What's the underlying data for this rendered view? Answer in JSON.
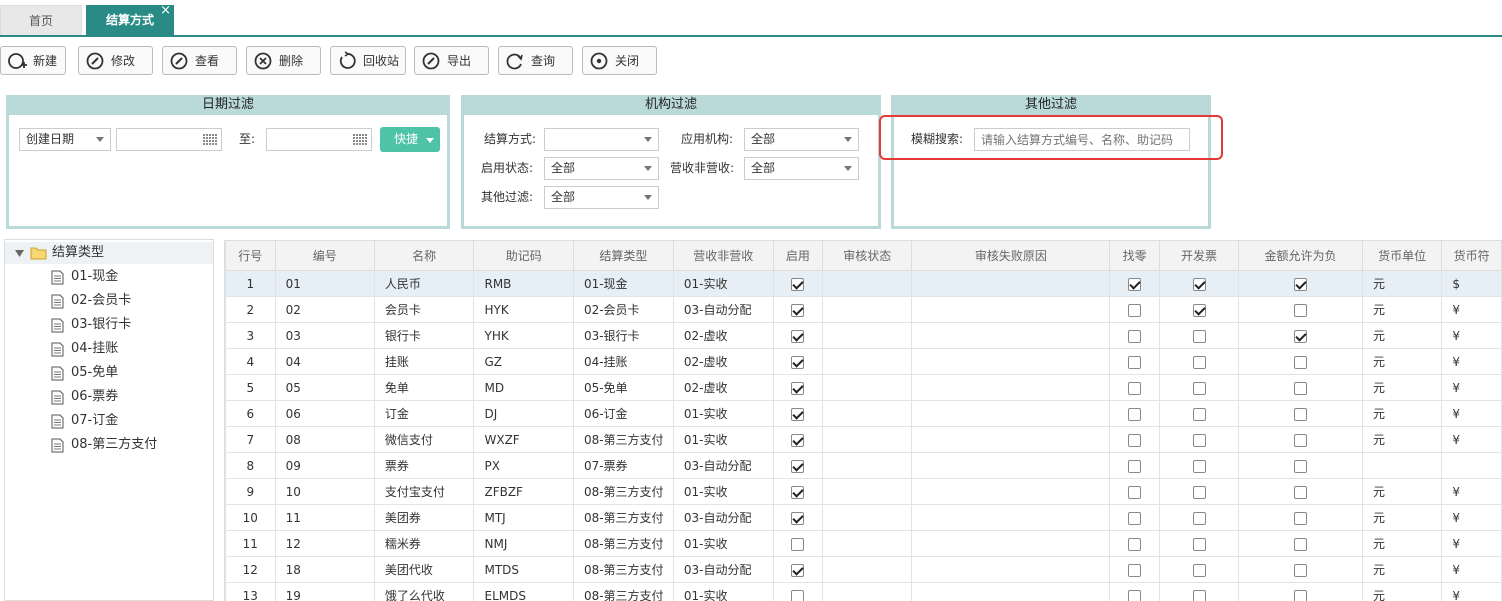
{
  "tabs": {
    "home": "首页",
    "active": "结算方式",
    "close": "×"
  },
  "toolbar": [
    {
      "name": "new",
      "label": "新建",
      "icon": "add-circle-icon"
    },
    {
      "name": "edit",
      "label": "修改",
      "icon": "edit-icon"
    },
    {
      "name": "view",
      "label": "查看",
      "icon": "view-icon"
    },
    {
      "name": "delete",
      "label": "删除",
      "icon": "delete-icon"
    },
    {
      "name": "recycle",
      "label": "回收站",
      "icon": "recycle-icon"
    },
    {
      "name": "export",
      "label": "导出",
      "icon": "export-icon"
    },
    {
      "name": "query",
      "label": "查询",
      "icon": "refresh-icon"
    },
    {
      "name": "close",
      "label": "关闭",
      "icon": "stop-icon"
    }
  ],
  "date_filter": {
    "title": "日期过滤",
    "date_type": "创建日期",
    "to_label": "至:",
    "quick_label": "快捷"
  },
  "org_filter": {
    "title": "机构过滤",
    "settle_label": "结算方式:",
    "settle_value": "",
    "org_label": "应用机构:",
    "org_value": "全部",
    "status_label": "启用状态:",
    "status_value": "全部",
    "revenue_label": "营收非营收:",
    "revenue_value": "全部",
    "other_label": "其他过滤:",
    "other_value": "全部"
  },
  "other_filter": {
    "title": "其他过滤",
    "search_label": "模糊搜索:",
    "search_placeholder": "请输入结算方式编号、名称、助记码"
  },
  "tree": {
    "root": "结算类型",
    "items": [
      "01-现金",
      "02-会员卡",
      "03-银行卡",
      "04-挂账",
      "05-免单",
      "06-票券",
      "07-订金",
      "08-第三方支付"
    ]
  },
  "grid": {
    "headers": [
      "行号",
      "编号",
      "名称",
      "助记码",
      "结算类型",
      "营收非营收",
      "启用",
      "审核状态",
      "审核失败原因",
      "找零",
      "开发票",
      "金额允许为负",
      "货币单位",
      "货币符"
    ],
    "rows": [
      {
        "no": "1",
        "code": "01",
        "name": "人民币",
        "abbr": "RMB",
        "type": "01-现金",
        "rev": "01-实收",
        "enabled": true,
        "change": true,
        "invoice": true,
        "negative": true,
        "unit": "元",
        "symbol": "$"
      },
      {
        "no": "2",
        "code": "02",
        "name": "会员卡",
        "abbr": "HYK",
        "type": "02-会员卡",
        "rev": "03-自动分配",
        "enabled": true,
        "change": false,
        "invoice": true,
        "negative": false,
        "unit": "元",
        "symbol": "¥"
      },
      {
        "no": "3",
        "code": "03",
        "name": "银行卡",
        "abbr": "YHK",
        "type": "03-银行卡",
        "rev": "02-虚收",
        "enabled": true,
        "change": false,
        "invoice": false,
        "negative": true,
        "unit": "元",
        "symbol": "¥"
      },
      {
        "no": "4",
        "code": "04",
        "name": "挂账",
        "abbr": "GZ",
        "type": "04-挂账",
        "rev": "02-虚收",
        "enabled": true,
        "change": false,
        "invoice": false,
        "negative": false,
        "unit": "元",
        "symbol": "¥"
      },
      {
        "no": "5",
        "code": "05",
        "name": "免单",
        "abbr": "MD",
        "type": "05-免单",
        "rev": "02-虚收",
        "enabled": true,
        "change": false,
        "invoice": false,
        "negative": false,
        "unit": "元",
        "symbol": "¥"
      },
      {
        "no": "6",
        "code": "06",
        "name": "订金",
        "abbr": "DJ",
        "type": "06-订金",
        "rev": "01-实收",
        "enabled": true,
        "change": false,
        "invoice": false,
        "negative": false,
        "unit": "元",
        "symbol": "¥"
      },
      {
        "no": "7",
        "code": "08",
        "name": "微信支付",
        "abbr": "WXZF",
        "type": "08-第三方支付",
        "rev": "01-实收",
        "enabled": true,
        "change": false,
        "invoice": false,
        "negative": false,
        "unit": "元",
        "symbol": "¥"
      },
      {
        "no": "8",
        "code": "09",
        "name": "票券",
        "abbr": "PX",
        "type": "07-票券",
        "rev": "03-自动分配",
        "enabled": true,
        "change": false,
        "invoice": false,
        "negative": false,
        "unit": "",
        "symbol": ""
      },
      {
        "no": "9",
        "code": "10",
        "name": "支付宝支付",
        "abbr": "ZFBZF",
        "type": "08-第三方支付",
        "rev": "01-实收",
        "enabled": true,
        "change": false,
        "invoice": false,
        "negative": false,
        "unit": "元",
        "symbol": "¥"
      },
      {
        "no": "10",
        "code": "11",
        "name": "美团券",
        "abbr": "MTJ",
        "type": "08-第三方支付",
        "rev": "03-自动分配",
        "enabled": true,
        "change": false,
        "invoice": false,
        "negative": false,
        "unit": "元",
        "symbol": "¥"
      },
      {
        "no": "11",
        "code": "12",
        "name": "糯米券",
        "abbr": "NMJ",
        "type": "08-第三方支付",
        "rev": "01-实收",
        "enabled": false,
        "change": false,
        "invoice": false,
        "negative": false,
        "unit": "元",
        "symbol": "¥"
      },
      {
        "no": "12",
        "code": "18",
        "name": "美团代收",
        "abbr": "MTDS",
        "type": "08-第三方支付",
        "rev": "03-自动分配",
        "enabled": true,
        "change": false,
        "invoice": false,
        "negative": false,
        "unit": "元",
        "symbol": "¥"
      },
      {
        "no": "13",
        "code": "19",
        "name": "饿了么代收",
        "abbr": "ELMDS",
        "type": "08-第三方支付",
        "rev": "01-实收",
        "enabled": false,
        "change": false,
        "invoice": false,
        "negative": false,
        "unit": "元",
        "symbol": "¥"
      }
    ]
  }
}
